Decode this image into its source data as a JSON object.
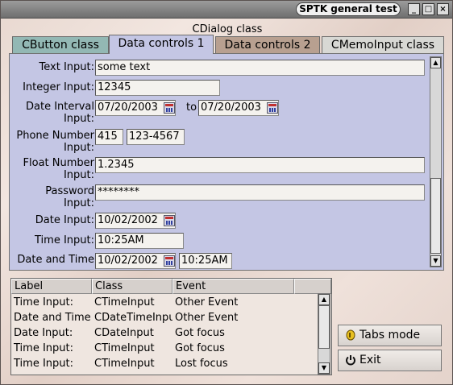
{
  "window": {
    "title": "SPTK general test",
    "controls": [
      "_",
      "□",
      "×"
    ]
  },
  "dialog": {
    "caption": "CDialog class",
    "tabs": [
      {
        "label": "CButton class",
        "color": "#93b8b4"
      },
      {
        "label": "Data controls 1",
        "color": "#c4c6e4"
      },
      {
        "label": "Data controls 2",
        "color": "#b8a090"
      },
      {
        "label": "CMemoInput class",
        "color": "#d8d8d4"
      }
    ]
  },
  "form": {
    "text_input": {
      "label": "Text Input:",
      "value": "some text"
    },
    "integer_input": {
      "label": "Integer Input:",
      "value": "12345"
    },
    "date_interval": {
      "label_line1": "Date Interval",
      "label_line2": "Input:",
      "from": "07/20/2003",
      "to_label": "to",
      "to": "07/20/2003"
    },
    "phone_number": {
      "label_line1": "Phone Number",
      "label_line2": "Input:",
      "area": "415",
      "number": "123-4567"
    },
    "float_number": {
      "label_line1": "Float Number",
      "label_line2": "Input:",
      "value": "1.2345"
    },
    "password": {
      "label_line1": "Password",
      "label_line2": "Input:",
      "value": "********"
    },
    "date_input": {
      "label": "Date Input:",
      "value": "10/02/2002"
    },
    "time_input": {
      "label": "Time Input:",
      "value": "10:25AM"
    },
    "date_time": {
      "label": "Date and Time",
      "date": "10/02/2002",
      "time": "10:25AM"
    }
  },
  "event_list": {
    "columns": [
      "Label",
      "Class",
      "Event"
    ],
    "rows": [
      {
        "label": "Time Input:",
        "class": "CTimeInput",
        "event": "Other Event"
      },
      {
        "label": "Date and Time",
        "class": "CDateTimeInpu",
        "event": "Other Event"
      },
      {
        "label": "Date Input:",
        "class": "CDateInput",
        "event": "Got focus"
      },
      {
        "label": "Time Input:",
        "class": "CTimeInput",
        "event": "Got focus"
      },
      {
        "label": "Time Input:",
        "class": "CTimeInput",
        "event": "Lost focus"
      }
    ]
  },
  "buttons": {
    "tabs_mode": {
      "label": "Tabs mode",
      "icon": "tabs-mode-icon"
    },
    "exit": {
      "label": "Exit",
      "icon": "power-icon"
    }
  }
}
